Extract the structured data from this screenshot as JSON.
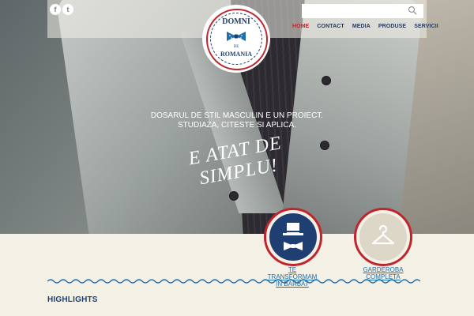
{
  "header": {
    "social": [
      {
        "icon": "facebook-icon",
        "glyph": "f"
      },
      {
        "icon": "twitter-icon",
        "glyph": "t"
      }
    ],
    "search": {
      "placeholder": "",
      "icon": "search-icon"
    },
    "nav": [
      {
        "label": "HOME",
        "active": true
      },
      {
        "label": "CONTACT",
        "active": false
      },
      {
        "label": "MEDIA",
        "active": false
      },
      {
        "label": "PRODUSE",
        "active": false
      },
      {
        "label": "SERVICII",
        "active": false
      }
    ]
  },
  "logo": {
    "line1": "DOMNI",
    "line2": "DE",
    "line3": "ROMANIA"
  },
  "hero": {
    "tagline_line1": "DOSARUL DE STIL MASCULIN E UN PROIECT.",
    "tagline_line2": "STUDIAZA, CITESTE SI APLICA.",
    "slogan": "E ATAT DE SIMPLU!"
  },
  "features": [
    {
      "icon": "top-hat-bowtie-icon",
      "label_line1": "TE TRANSFORMAM",
      "label_line2": "IN BARBAT",
      "color": "#1f3f72"
    },
    {
      "icon": "hanger-icon",
      "label_line1": "GARDEROBA",
      "label_line2": "COMPLETA",
      "color": "#ddd7c8"
    }
  ],
  "section": {
    "highlights_title": "HIGHLIGHTS"
  },
  "colors": {
    "accent_red": "#c0252e",
    "navy": "#1f3f72",
    "link_blue": "#1f6fa8",
    "background": "#f3f0e6"
  }
}
